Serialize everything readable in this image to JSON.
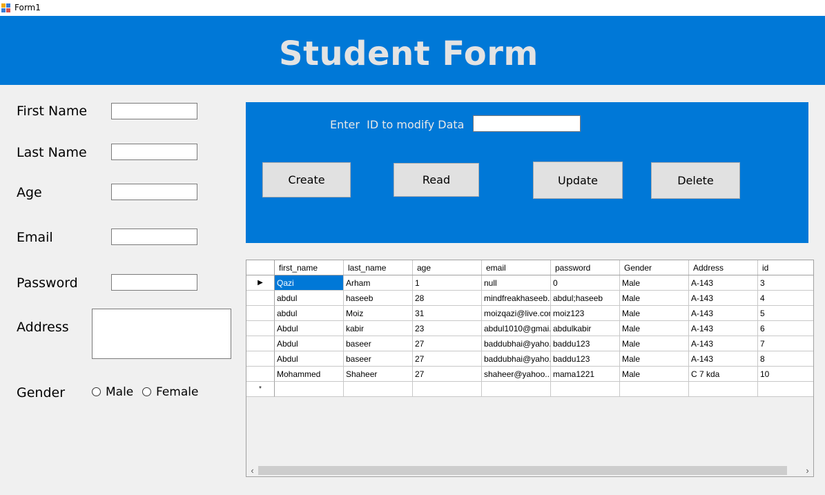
{
  "window": {
    "title": "Form1"
  },
  "header": {
    "title": "Student Form"
  },
  "form": {
    "first_name_label": "First Name",
    "last_name_label": "Last Name",
    "age_label": "Age",
    "email_label": "Email",
    "password_label": "Password",
    "address_label": "Address",
    "gender_label": "Gender",
    "first_name_value": "",
    "last_name_value": "",
    "age_value": "",
    "email_value": "",
    "password_value": "",
    "address_value": "",
    "gender_options": [
      "Male",
      "Female"
    ]
  },
  "panel": {
    "id_label": "Enter  ID to modify Data",
    "id_value": "",
    "buttons": {
      "create": "Create",
      "read": "Read",
      "update": "Update",
      "delete": "Delete"
    }
  },
  "grid": {
    "columns": [
      "first_name",
      "last_name",
      "age",
      "email",
      "password",
      "Gender",
      "Address",
      "id"
    ],
    "rows": [
      [
        "Qazi",
        "Arham",
        "1",
        "null",
        "0",
        "Male",
        "A-143",
        "3"
      ],
      [
        "abdul",
        "haseeb",
        "28",
        "mindfreakhaseeb...",
        "abdul;haseeb",
        "Male",
        "A-143",
        "4"
      ],
      [
        "abdul",
        "Moiz",
        "31",
        "moizqazi@live.com",
        "moiz123",
        "Male",
        "A-143",
        "5"
      ],
      [
        "Abdul",
        "kabir",
        "23",
        "abdul1010@gmai...",
        "abdulkabir",
        "Male",
        "A-143",
        "6"
      ],
      [
        "Abdul",
        "baseer",
        "27",
        "baddubhai@yaho...",
        "baddu123",
        "Male",
        "A-143",
        "7"
      ],
      [
        "Abdul",
        "baseer",
        "27",
        "baddubhai@yaho...",
        "baddu123",
        "Male",
        "A-143",
        "8"
      ],
      [
        "Mohammed",
        "Shaheer",
        "27",
        "shaheer@yahoo....",
        "mama1221",
        "Male",
        "C 7 kda",
        "10"
      ]
    ],
    "current_row_marker": "▶",
    "new_row_marker": "*",
    "selected_cell": "row 0, first_name"
  },
  "icons": {
    "app": "form-app-icon",
    "scroll_left": "chevron-left-icon",
    "scroll_right": "chevron-right-icon"
  },
  "colors": {
    "accent": "#0078d7",
    "header_text": "#e3e3e3",
    "button_face": "#e1e1e1"
  }
}
